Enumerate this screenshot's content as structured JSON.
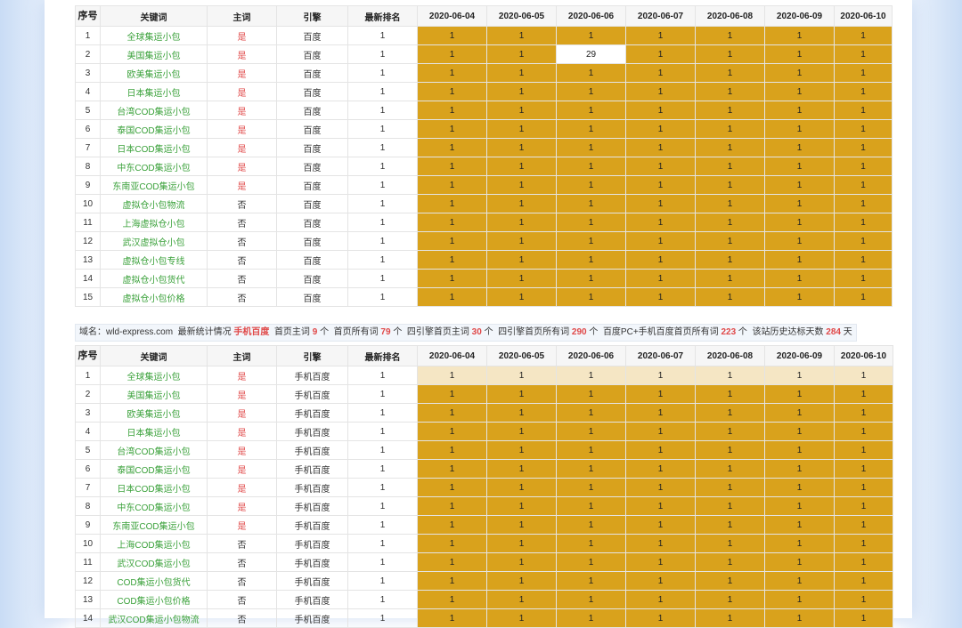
{
  "headers": [
    "序号",
    "关键词",
    "主词",
    "引擎",
    "最新排名",
    "2020-06-04",
    "2020-06-05",
    "2020-06-06",
    "2020-06-07",
    "2020-06-08",
    "2020-06-09",
    "2020-06-10"
  ],
  "table1": {
    "engine": "百度",
    "rows": [
      {
        "no": "1",
        "kw": "全球集运小包",
        "main": "是",
        "rank": "1",
        "days": [
          "1",
          "1",
          "1",
          "1",
          "1",
          "1",
          "1"
        ]
      },
      {
        "no": "2",
        "kw": "美国集运小包",
        "main": "是",
        "rank": "1",
        "days": [
          "1",
          "1",
          "29",
          "1",
          "1",
          "1",
          "1"
        ]
      },
      {
        "no": "3",
        "kw": "欧美集运小包",
        "main": "是",
        "rank": "1",
        "days": [
          "1",
          "1",
          "1",
          "1",
          "1",
          "1",
          "1"
        ]
      },
      {
        "no": "4",
        "kw": "日本集运小包",
        "main": "是",
        "rank": "1",
        "days": [
          "1",
          "1",
          "1",
          "1",
          "1",
          "1",
          "1"
        ]
      },
      {
        "no": "5",
        "kw": "台湾COD集运小包",
        "main": "是",
        "rank": "1",
        "days": [
          "1",
          "1",
          "1",
          "1",
          "1",
          "1",
          "1"
        ]
      },
      {
        "no": "6",
        "kw": "泰国COD集运小包",
        "main": "是",
        "rank": "1",
        "days": [
          "1",
          "1",
          "1",
          "1",
          "1",
          "1",
          "1"
        ]
      },
      {
        "no": "7",
        "kw": "日本COD集运小包",
        "main": "是",
        "rank": "1",
        "days": [
          "1",
          "1",
          "1",
          "1",
          "1",
          "1",
          "1"
        ]
      },
      {
        "no": "8",
        "kw": "中东COD集运小包",
        "main": "是",
        "rank": "1",
        "days": [
          "1",
          "1",
          "1",
          "1",
          "1",
          "1",
          "1"
        ]
      },
      {
        "no": "9",
        "kw": "东南亚COD集运小包",
        "main": "是",
        "rank": "1",
        "days": [
          "1",
          "1",
          "1",
          "1",
          "1",
          "1",
          "1"
        ]
      },
      {
        "no": "10",
        "kw": "虚拟仓小包物流",
        "main": "否",
        "rank": "1",
        "days": [
          "1",
          "1",
          "1",
          "1",
          "1",
          "1",
          "1"
        ]
      },
      {
        "no": "11",
        "kw": "上海虚拟仓小包",
        "main": "否",
        "rank": "1",
        "days": [
          "1",
          "1",
          "1",
          "1",
          "1",
          "1",
          "1"
        ]
      },
      {
        "no": "12",
        "kw": "武汉虚拟仓小包",
        "main": "否",
        "rank": "1",
        "days": [
          "1",
          "1",
          "1",
          "1",
          "1",
          "1",
          "1"
        ]
      },
      {
        "no": "13",
        "kw": "虚拟仓小包专线",
        "main": "否",
        "rank": "1",
        "days": [
          "1",
          "1",
          "1",
          "1",
          "1",
          "1",
          "1"
        ]
      },
      {
        "no": "14",
        "kw": "虚拟仓小包货代",
        "main": "否",
        "rank": "1",
        "days": [
          "1",
          "1",
          "1",
          "1",
          "1",
          "1",
          "1"
        ]
      },
      {
        "no": "15",
        "kw": "虚拟仓小包价格",
        "main": "否",
        "rank": "1",
        "days": [
          "1",
          "1",
          "1",
          "1",
          "1",
          "1",
          "1"
        ]
      }
    ]
  },
  "summary": {
    "domain_label": "域名：",
    "domain": "wld-express.com",
    "stat_label": "最新统计情况",
    "engine_name": "手机百度",
    "home_main_label": "首页主词",
    "home_main": "9",
    "home_all_label": "首页所有词",
    "home_all": "79",
    "four_main_label": "四引擎首页主词",
    "four_main": "30",
    "four_all_label": "四引擎首页所有词",
    "four_all": "290",
    "pc_mobile_label": "百度PC+手机百度首页所有词",
    "pc_mobile": "223",
    "days_label": "该站历史达标天数",
    "days": "284",
    "unit_ge": "个",
    "unit_tian": "天"
  },
  "table2": {
    "engine": "手机百度",
    "rows": [
      {
        "no": "1",
        "kw": "全球集运小包",
        "main": "是",
        "rank": "1",
        "days": [
          "1",
          "1",
          "1",
          "1",
          "1",
          "1",
          "1"
        ]
      },
      {
        "no": "2",
        "kw": "美国集运小包",
        "main": "是",
        "rank": "1",
        "days": [
          "1",
          "1",
          "1",
          "1",
          "1",
          "1",
          "1"
        ]
      },
      {
        "no": "3",
        "kw": "欧美集运小包",
        "main": "是",
        "rank": "1",
        "days": [
          "1",
          "1",
          "1",
          "1",
          "1",
          "1",
          "1"
        ]
      },
      {
        "no": "4",
        "kw": "日本集运小包",
        "main": "是",
        "rank": "1",
        "days": [
          "1",
          "1",
          "1",
          "1",
          "1",
          "1",
          "1"
        ]
      },
      {
        "no": "5",
        "kw": "台湾COD集运小包",
        "main": "是",
        "rank": "1",
        "days": [
          "1",
          "1",
          "1",
          "1",
          "1",
          "1",
          "1"
        ]
      },
      {
        "no": "6",
        "kw": "泰国COD集运小包",
        "main": "是",
        "rank": "1",
        "days": [
          "1",
          "1",
          "1",
          "1",
          "1",
          "1",
          "1"
        ]
      },
      {
        "no": "7",
        "kw": "日本COD集运小包",
        "main": "是",
        "rank": "1",
        "days": [
          "1",
          "1",
          "1",
          "1",
          "1",
          "1",
          "1"
        ]
      },
      {
        "no": "8",
        "kw": "中东COD集运小包",
        "main": "是",
        "rank": "1",
        "days": [
          "1",
          "1",
          "1",
          "1",
          "1",
          "1",
          "1"
        ]
      },
      {
        "no": "9",
        "kw": "东南亚COD集运小包",
        "main": "是",
        "rank": "1",
        "days": [
          "1",
          "1",
          "1",
          "1",
          "1",
          "1",
          "1"
        ]
      },
      {
        "no": "10",
        "kw": "上海COD集运小包",
        "main": "否",
        "rank": "1",
        "days": [
          "1",
          "1",
          "1",
          "1",
          "1",
          "1",
          "1"
        ]
      },
      {
        "no": "11",
        "kw": "武汉COD集运小包",
        "main": "否",
        "rank": "1",
        "days": [
          "1",
          "1",
          "1",
          "1",
          "1",
          "1",
          "1"
        ]
      },
      {
        "no": "12",
        "kw": "COD集运小包货代",
        "main": "否",
        "rank": "1",
        "days": [
          "1",
          "1",
          "1",
          "1",
          "1",
          "1",
          "1"
        ]
      },
      {
        "no": "13",
        "kw": "COD集运小包价格",
        "main": "否",
        "rank": "1",
        "days": [
          "1",
          "1",
          "1",
          "1",
          "1",
          "1",
          "1"
        ]
      },
      {
        "no": "14",
        "kw": "武汉COD集运小包物流",
        "main": "否",
        "rank": "1",
        "days": [
          "1",
          "1",
          "1",
          "1",
          "1",
          "1",
          "1"
        ]
      }
    ]
  },
  "colors": {
    "rank_top": "#d9a21c",
    "rank_light": "#f5e6c4",
    "keyword": "#3aa13a",
    "yes": "#e04848"
  }
}
